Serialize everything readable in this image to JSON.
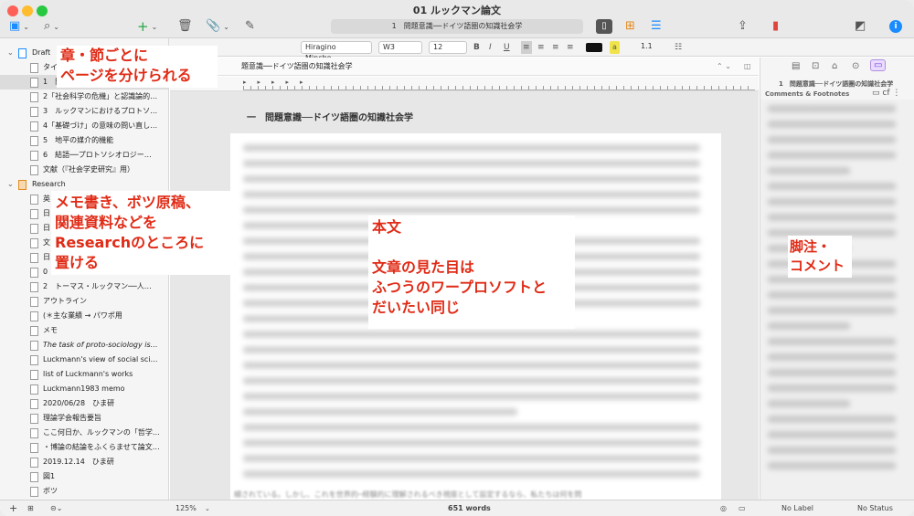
{
  "window": {
    "title": "01 ルックマン論文",
    "doc_path": "1　問題意識──ドイツ語圏の知識社会学"
  },
  "format_bar": {
    "style": "¶",
    "font": "Hiragino Mincho...",
    "weight": "W3",
    "size": "12",
    "spacing": "1.1",
    "bold": "B",
    "italic": "I",
    "underline": "U"
  },
  "sidebar": {
    "draft_label": "Draft",
    "draft_items": [
      {
        "label": "タイト"
      },
      {
        "label": "1　問"
      },
      {
        "label": "2「社会科学の危機」と認識論的…"
      },
      {
        "label": "3　ルックマンにおけるプロトソ…"
      },
      {
        "label": "4「基礎づけ」の意味の問い直し…"
      },
      {
        "label": "5　地平の媒介的機能"
      },
      {
        "label": "6　結語──プロトソシオロジー…"
      },
      {
        "label": "文献（『社会学史研究』用）"
      }
    ],
    "research_label": "Research",
    "research_items": [
      {
        "label": "英"
      },
      {
        "label": "日"
      },
      {
        "label": "日"
      },
      {
        "label": "文"
      },
      {
        "label": "日"
      },
      {
        "label": "0"
      },
      {
        "label": "2　トーマス・ルックマン──人…"
      },
      {
        "label": "アウトライン"
      },
      {
        "label": "(＊主な業績 → パワポ用"
      },
      {
        "label": "メモ"
      },
      {
        "label": "The task of proto-sociology is…"
      },
      {
        "label": "Luckmann's view of social sci…"
      },
      {
        "label": "list of Luckmann's works"
      },
      {
        "label": "Luckmann1983 memo"
      },
      {
        "label": "2020/06/28　ひま研"
      },
      {
        "label": "理論学会報告要旨"
      },
      {
        "label": "ここ何日か、ルックマンの「哲学…"
      },
      {
        "label": "・博論の結論をふくらませて論文…"
      },
      {
        "label": "2019.12.14　ひま研"
      },
      {
        "label": "図1"
      },
      {
        "label": "ボツ"
      }
    ]
  },
  "editor": {
    "header_title": "題意識──ドイツ語圏の知識社会学",
    "chapter_heading": "一　問題意識──ドイツ語圏の知識社会学",
    "bottom_text": "細されている。しかし、これを世界的─経験的に理解されるべき視座として設定するなら、私たちは何を問"
  },
  "inspector": {
    "doc_title": "1　問題意識──ドイツ語圏の知識社会学",
    "section_label": "Comments & Footnotes"
  },
  "status": {
    "zoom": "125%",
    "words": "651 words",
    "label": "No Label",
    "status": "No Status"
  },
  "annotations": {
    "a1_line1": "章・節ごとに",
    "a1_line2": "ページを分けられる",
    "a2_line1": "メモ書き、ボツ原稿、",
    "a2_line2": "関連資料などを",
    "a2_line3": "Researchのところに",
    "a2_line4": "置ける",
    "a3_line1": "本文",
    "a3_line2": "文章の見た目は",
    "a3_line3": "ふつうのワープロソフトと",
    "a3_line4": "だいたい同じ",
    "a4_line1": "脚注・",
    "a4_line2": "コメント"
  },
  "colors": {
    "accent_red": "#e02b16",
    "bookmark": "#e0443a",
    "info": "#1a8cff",
    "add_green": "#28a745"
  }
}
